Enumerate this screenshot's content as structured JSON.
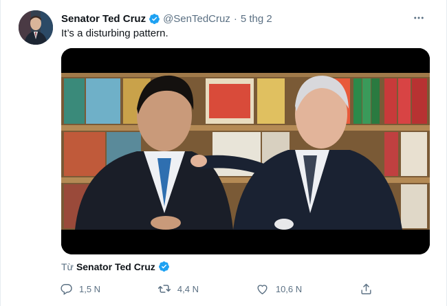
{
  "tweet": {
    "author_name": "Senator Ted Cruz",
    "author_handle": "@SenTedCruz",
    "separator": "·",
    "timestamp": "5 thg 2",
    "text": "It’s a disturbing pattern.",
    "more_icon": "ellipsis-icon",
    "verified_icon": "verified-badge-icon"
  },
  "credit": {
    "prefix": "Từ",
    "name": "Senator Ted Cruz"
  },
  "actions": {
    "reply_count": "1,5 N",
    "retweet_count": "4,4 N",
    "like_count": "10,6 N",
    "reply_icon": "reply-icon",
    "retweet_icon": "retweet-icon",
    "like_icon": "heart-icon",
    "share_icon": "share-icon"
  },
  "colors": {
    "verified": "#1da1f2",
    "secondary_text": "#5b7083",
    "primary_text": "#0f1419"
  }
}
